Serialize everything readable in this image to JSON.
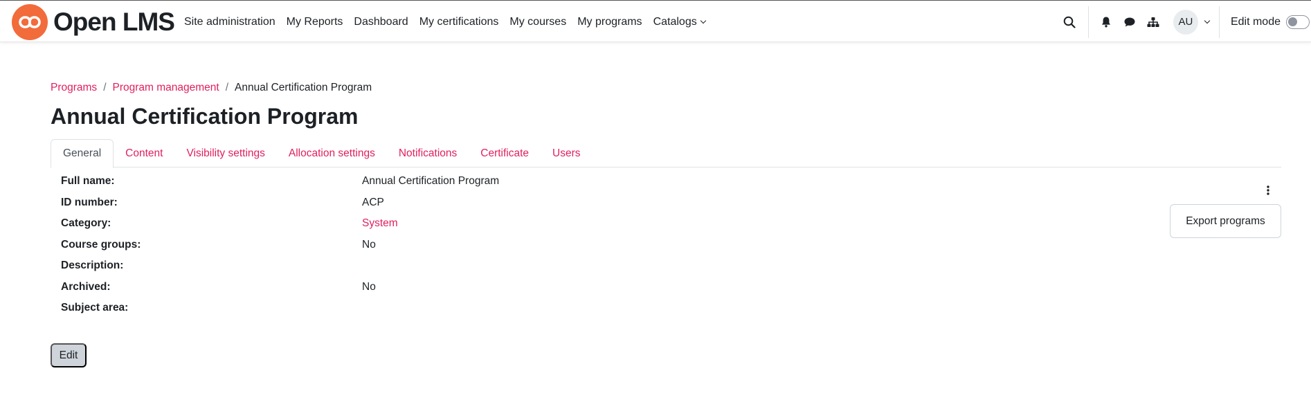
{
  "brand": {
    "name": "Open LMS",
    "accent": "#f26b3a",
    "link_color": "#e0205e"
  },
  "nav": {
    "items": [
      {
        "label": "Site administration"
      },
      {
        "label": "My Reports"
      },
      {
        "label": "Dashboard"
      },
      {
        "label": "My certifications"
      },
      {
        "label": "My courses"
      },
      {
        "label": "My programs"
      },
      {
        "label": "Catalogs",
        "dropdown": true
      }
    ],
    "icons": [
      "search-icon",
      "bell-icon",
      "chat-icon",
      "sitemap-icon"
    ],
    "user_initials": "AU",
    "edit_mode_label": "Edit mode",
    "edit_mode_on": false
  },
  "breadcrumb": {
    "items": [
      {
        "label": "Programs"
      },
      {
        "label": "Program management"
      }
    ],
    "separator": "/",
    "current": "Annual Certification Program"
  },
  "page": {
    "title": "Annual Certification Program"
  },
  "tabs": [
    {
      "label": "General",
      "active": true
    },
    {
      "label": "Content"
    },
    {
      "label": "Visibility settings"
    },
    {
      "label": "Allocation settings"
    },
    {
      "label": "Notifications"
    },
    {
      "label": "Certificate"
    },
    {
      "label": "Users"
    }
  ],
  "details": [
    {
      "label": "Full name:",
      "value": "Annual Certification Program"
    },
    {
      "label": "ID number:",
      "value": "ACP"
    },
    {
      "label": "Category:",
      "value": "System",
      "link": true
    },
    {
      "label": "Course groups:",
      "value": "No"
    },
    {
      "label": "Description:",
      "value": ""
    },
    {
      "label": "Archived:",
      "value": "No"
    },
    {
      "label": "Subject area:",
      "value": ""
    }
  ],
  "actions": {
    "export_label": "Export programs",
    "edit_label": "Edit"
  }
}
